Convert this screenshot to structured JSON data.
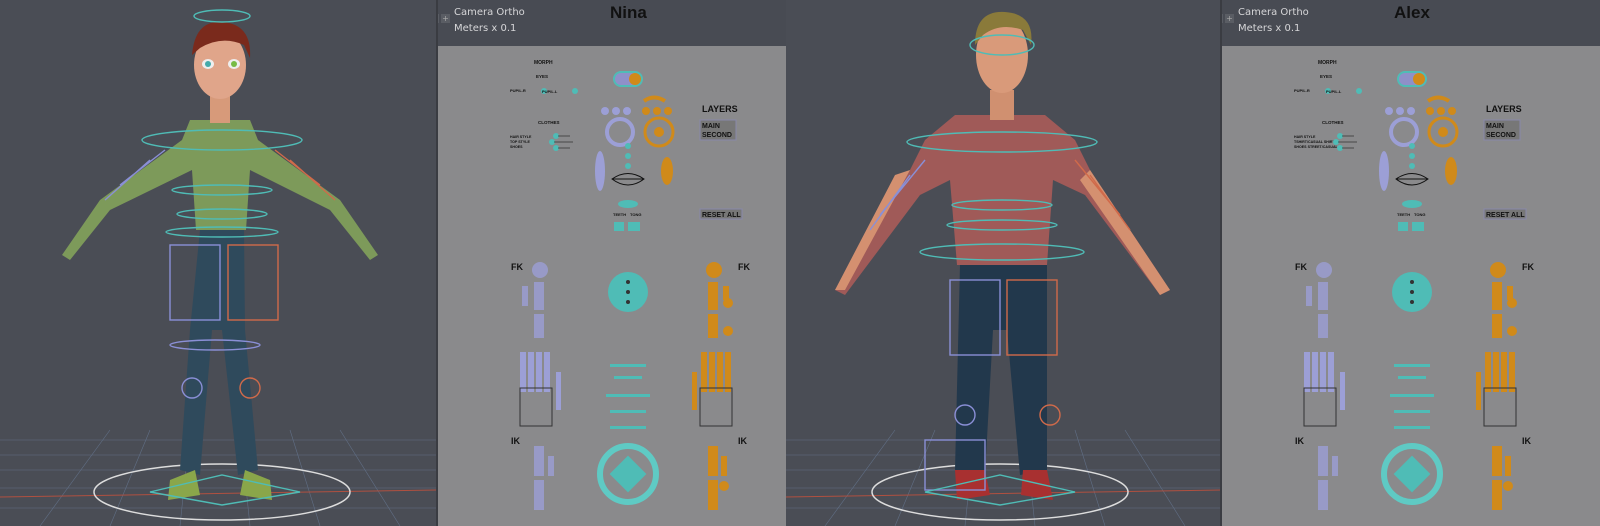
{
  "colors": {
    "viewport": "#4a4d55",
    "picker_bg": "#8a8a8c",
    "header": "#484b53",
    "left": "#9c9fd6",
    "right": "#d08a1a",
    "center": "#4fbcb6"
  },
  "panels": [
    {
      "title": "Nina",
      "camera": "Camera Ortho",
      "units": "Meters x 0.1",
      "morph": "MORPH",
      "eyes": "EYES",
      "pupil_r": "PUPIL.R",
      "pupil_l": "PUPIL.L",
      "clothes": "CLOTHES",
      "clothes_items": [
        "HAIR STYLE",
        "TOP STYLE",
        "SHOES"
      ],
      "layers": "LAYERS",
      "main": "MAIN",
      "second": "SECOND",
      "reset": "RESET ALL",
      "teeth": "TEETH",
      "tong": "TONG",
      "fk": "FK",
      "ik": "IK"
    },
    {
      "title": "Alex",
      "camera": "Camera Ortho",
      "units": "Meters x 0.1",
      "morph": "MORPH",
      "eyes": "EYES",
      "pupil_r": "PUPIL.R",
      "pupil_l": "PUPIL.L",
      "clothes": "CLOTHES",
      "clothes_items": [
        "HAIR STYLE",
        "TSHIRT/CASUAL SHIRT",
        "SHOES STREET/CASUAL"
      ],
      "layers": "LAYERS",
      "main": "MAIN",
      "second": "SECOND",
      "reset": "RESET ALL",
      "teeth": "TEETH",
      "tong": "TONG",
      "fk": "FK",
      "ik": "IK"
    }
  ]
}
